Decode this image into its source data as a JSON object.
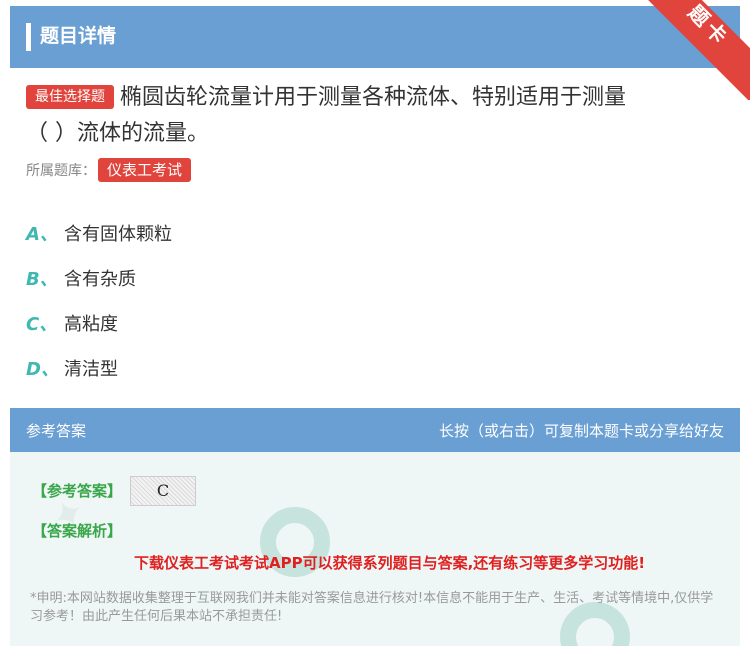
{
  "header": {
    "title": "题目详情",
    "ribbon_label": "题卡"
  },
  "question": {
    "type_tag": "最佳选择题",
    "text_line1": "椭圆齿轮流量计用于测量各种流体、特别适用于测量",
    "text_line2": "（  ）流体的流量。",
    "bank_label": "所属题库：",
    "bank_name": "仪表工考试"
  },
  "options": [
    {
      "letter": "A、",
      "text": "含有固体颗粒"
    },
    {
      "letter": "B、",
      "text": "含有杂质"
    },
    {
      "letter": "C、",
      "text": "高粘度"
    },
    {
      "letter": "D、",
      "text": "清洁型"
    }
  ],
  "answer_section": {
    "title": "参考答案",
    "share_hint": "长按（或右击）可复制本题卡或分享给好友",
    "answer_label": "【参考答案】",
    "answer_value": "C",
    "analysis_label": "【答案解析】",
    "promo": "下载仪表工考试考试APP可以获得系列题目与答案,还有练习等更多学习功能!",
    "disclaimer": "*申明:本网站数据收集整理于互联网我们并未能对答案信息进行核对!本信息不能用于生产、生活、考试等情境中,仅供学习参考！由此产生任何后果本站不承担责任!"
  },
  "colors": {
    "header_bg": "#6a9fd3",
    "tag_red": "#e0443c",
    "option_letter": "#3fb8b0",
    "answer_green": "#3aa64a",
    "promo_red": "#e02020"
  }
}
